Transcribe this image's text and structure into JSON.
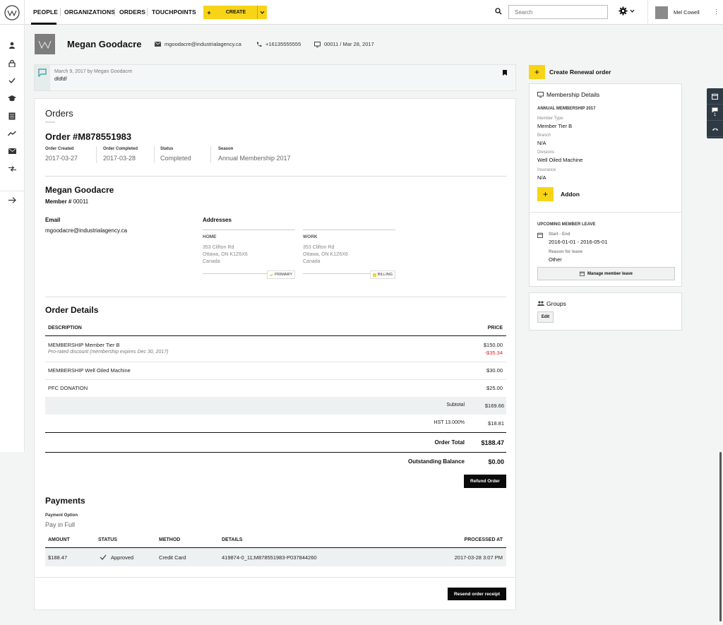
{
  "nav": {
    "items": [
      "PEOPLE",
      "ORGANIZATIONS",
      "ORDERS",
      "TOUCHPOINTS"
    ],
    "create_label": "CREATE",
    "search_placeholder": "Search",
    "user_name": "Mel Cowell"
  },
  "sidebar": {
    "icons": [
      "person-icon",
      "lock-icon",
      "check-icon",
      "graduation-cap-icon",
      "list-icon",
      "trend-icon",
      "mail-icon",
      "transfer-icon",
      "arrow-right-icon"
    ]
  },
  "profile": {
    "name": "Megan Goodacre",
    "email": "mgoodacre@industrialagency.ca",
    "phone": "+16135555555",
    "member_info": "00011 / Mar 28, 2017"
  },
  "note": {
    "meta": "March 9, 2017 by Megan Goodacre",
    "text": "dfdfdf"
  },
  "orders": {
    "section_title": "Orders",
    "order_number": "Order #M878551983",
    "summary": [
      {
        "label": "Order Created",
        "value": "2017-03-27"
      },
      {
        "label": "Order Completed",
        "value": "2017-03-28"
      },
      {
        "label": "Status",
        "value": "Completed"
      },
      {
        "label": "Season",
        "value": "Annual Membership 2017"
      }
    ],
    "customer": {
      "name": "Megan Goodacre",
      "member_label": "Member #",
      "member_number": "00011",
      "email_label": "Email",
      "email": "mgoodacre@industrialagency.ca",
      "addresses_label": "Addresses",
      "addresses": [
        {
          "type": "HOME",
          "line1": "353 Clifton Rd",
          "line2": "Ottawa, ON K1Z6X6",
          "line3": "Canada",
          "tag": "PRIMARY"
        },
        {
          "type": "WORK",
          "line1": "353 Clifton Rd",
          "line2": "Ottawa, ON K1Z6X6",
          "line3": "Canada",
          "tag": "BILLING"
        }
      ]
    },
    "details": {
      "title": "Order Details",
      "col_description": "DESCRIPTION",
      "col_price": "PRICE",
      "items": [
        {
          "description": "MEMBERSHIP Member Tier B",
          "sub": "Pro-rated discount (membership expires Dec 30, 2017)",
          "price": "$150.00",
          "discount": "-$35.34"
        },
        {
          "description": "MEMBERSHIP Well Oiled Machine",
          "price": "$30.00"
        },
        {
          "description": "PFC DONATION",
          "price": "$25.00"
        }
      ],
      "subtotal_label": "Subtotal",
      "subtotal": "$169.66",
      "tax_label": "HST 13.000%",
      "tax": "$18.81",
      "total_label": "Order Total",
      "total": "$188.47",
      "balance_label": "Outstanding Balance",
      "balance": "$0.00",
      "refund_label": "Refund Order"
    },
    "payments": {
      "title": "Payments",
      "option_label": "Payment Option",
      "option_value": "Pay in Full",
      "columns": [
        "AMOUNT",
        "STATUS",
        "METHOD",
        "DETAILS",
        "PROCESSED AT"
      ],
      "rows": [
        {
          "amount": "$188.47",
          "status": "Approved",
          "method": "Credit Card",
          "details": "419874-0_11;M878551983-P037844260",
          "processed": "2017-03-28 3:07 PM"
        }
      ],
      "resend_label": "Resend order receipt"
    }
  },
  "right_panel": {
    "create_renewal": "Create Renewal order",
    "membership": {
      "title": "Membership Details",
      "heading": "ANNUAL MEMBERSHIP 2017",
      "fields": [
        {
          "label": "Member Type",
          "value": "Member Tier B"
        },
        {
          "label": "Branch",
          "value": "N/A"
        },
        {
          "label": "Divisions",
          "value": "Well Oiled Machine"
        },
        {
          "label": "Insurance",
          "value": "N/A"
        }
      ],
      "addon": "Addon"
    },
    "leave": {
      "title": "UPCOMING MEMBER LEAVE",
      "range_label": "Start - End",
      "range": "2016-01-01 - 2016-05-01",
      "reason_label": "Reason for leave",
      "reason": "Other",
      "manage": "Manage member leave"
    },
    "groups": {
      "title": "Groups",
      "edit": "Edit"
    },
    "side_tabs": {
      "chat_count": "1"
    }
  },
  "colors": {
    "accent": "#f7d417",
    "discount": "#e0262a",
    "dark": "#0a0a0a",
    "tab_bg": "#2f3a45"
  }
}
